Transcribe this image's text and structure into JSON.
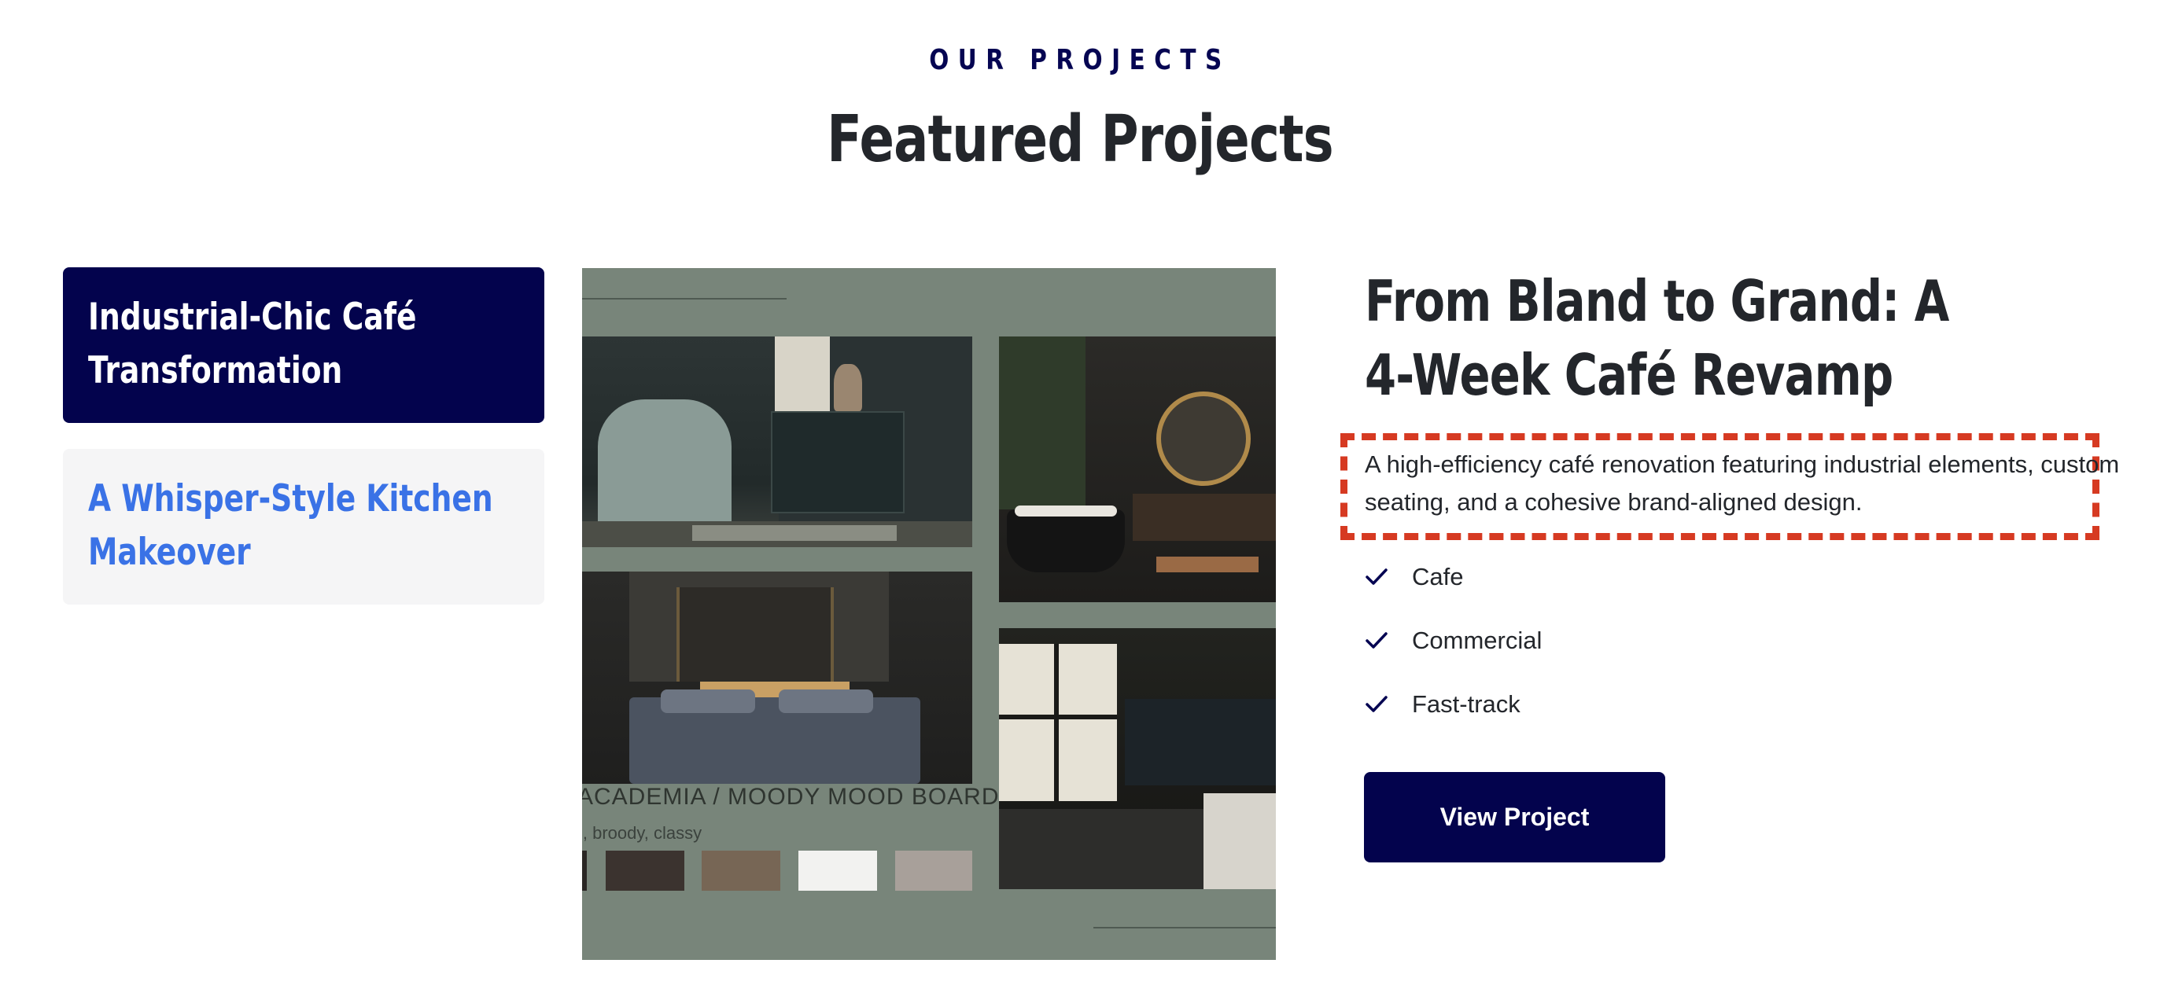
{
  "section": {
    "eyebrow": "OUR PROJECTS",
    "title": "Featured Projects"
  },
  "tabs": [
    {
      "label": "Industrial-Chic Café Transformation",
      "active": true
    },
    {
      "label": "A Whisper-Style Kitchen Makeover",
      "active": false
    }
  ],
  "image": {
    "caption": "ACADEMIA / MOODY MOOD BOARD",
    "subcaption": "l, broody, classy",
    "swatches": [
      "#2a2624",
      "#3b332f",
      "#776655",
      "#f2f2f0",
      "#a8a09a"
    ]
  },
  "project": {
    "title": "From Bland to Grand: A 4-Week Café Revamp",
    "description": "A high-efficiency café renovation featuring industrial elements, custom seating, and a cohesive brand-aligned design.",
    "features": [
      "Cafe",
      "Commercial",
      "Fast-track"
    ],
    "button_label": "View Project"
  },
  "colors": {
    "navy": "#03034d",
    "accent_blue": "#3a72e6",
    "highlight_red": "#d63a22"
  }
}
